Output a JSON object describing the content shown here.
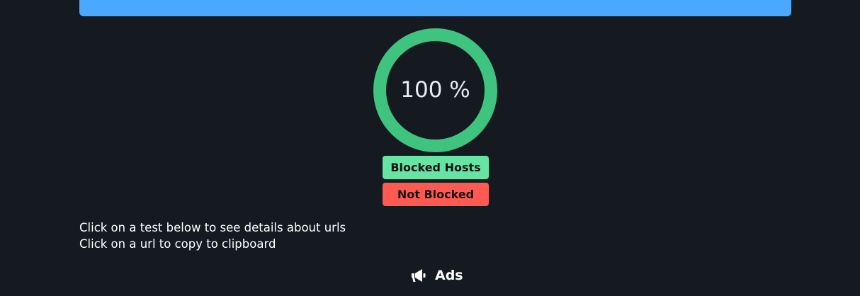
{
  "gauge": {
    "percent_label": "100 %",
    "percent_value": 100,
    "color": "#3ec47e"
  },
  "legend": {
    "blocked_label": "Blocked Hosts",
    "not_blocked_label": "Not Blocked",
    "blocked_color": "#66e4a4",
    "not_blocked_color": "#ff5a52"
  },
  "instructions": {
    "line1": "Click on a test below to see details about urls",
    "line2": "Click on a url to copy to clipboard"
  },
  "section": {
    "icon": "megaphone-icon",
    "title": "Ads"
  },
  "colors": {
    "background": "#151a20",
    "top_bar": "#4aa8ff"
  }
}
